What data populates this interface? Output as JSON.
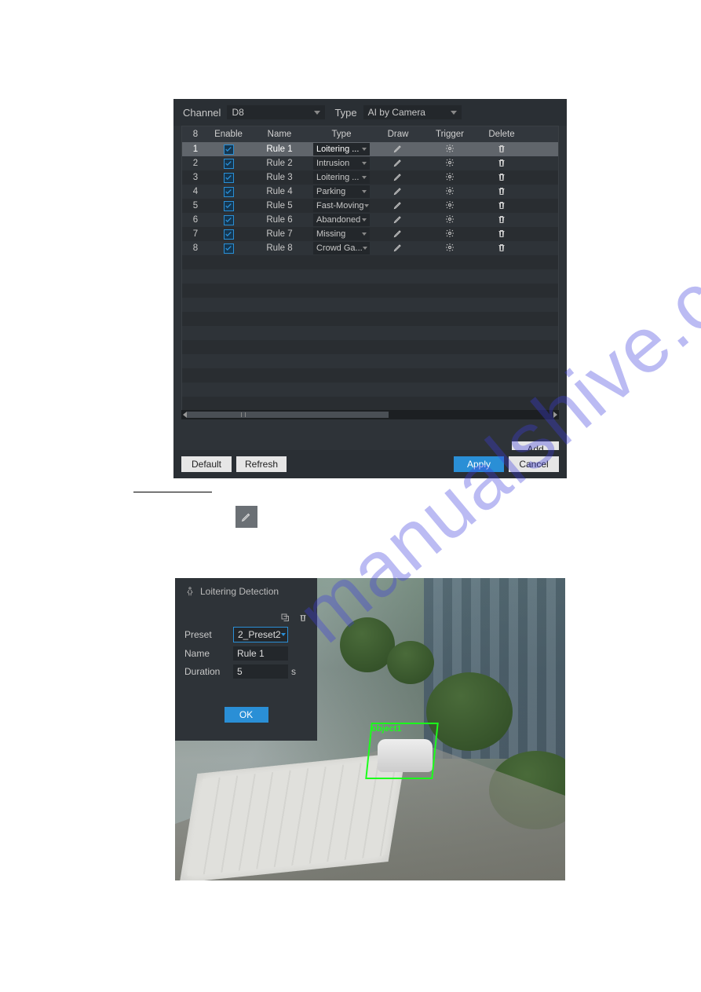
{
  "topbar": {
    "channel_label": "Channel",
    "channel_value": "D8",
    "type_label": "Type",
    "type_value": "AI by Camera"
  },
  "headers": {
    "num": "8",
    "enable": "Enable",
    "name": "Name",
    "type": "Type",
    "draw": "Draw",
    "trigger": "Trigger",
    "delete": "Delete"
  },
  "rules": [
    {
      "num": "1",
      "enabled": true,
      "name": "Rule 1",
      "type": "Loitering ...",
      "selected": true
    },
    {
      "num": "2",
      "enabled": true,
      "name": "Rule 2",
      "type": "Intrusion"
    },
    {
      "num": "3",
      "enabled": true,
      "name": "Rule 3",
      "type": "Loitering ..."
    },
    {
      "num": "4",
      "enabled": true,
      "name": "Rule 4",
      "type": "Parking"
    },
    {
      "num": "5",
      "enabled": true,
      "name": "Rule 5",
      "type": "Fast-Moving"
    },
    {
      "num": "6",
      "enabled": true,
      "name": "Rule 6",
      "type": "Abandoned"
    },
    {
      "num": "7",
      "enabled": true,
      "name": "Rule 7",
      "type": "Missing"
    },
    {
      "num": "8",
      "enabled": true,
      "name": "Rule 8",
      "type": "Crowd Ga..."
    }
  ],
  "buttons": {
    "add": "Add",
    "default": "Default",
    "refresh": "Refresh",
    "apply": "Apply",
    "cancel": "Cancel"
  },
  "dialog": {
    "title": "Loitering Detection",
    "preset_label": "Preset",
    "preset_value": "2_Preset2",
    "name_label": "Name",
    "name_value": "Rule 1",
    "duration_label": "Duration",
    "duration_value": "5",
    "duration_unit": "s",
    "ok": "OK",
    "detect_label": "object1"
  },
  "watermark": "manualshive.com"
}
